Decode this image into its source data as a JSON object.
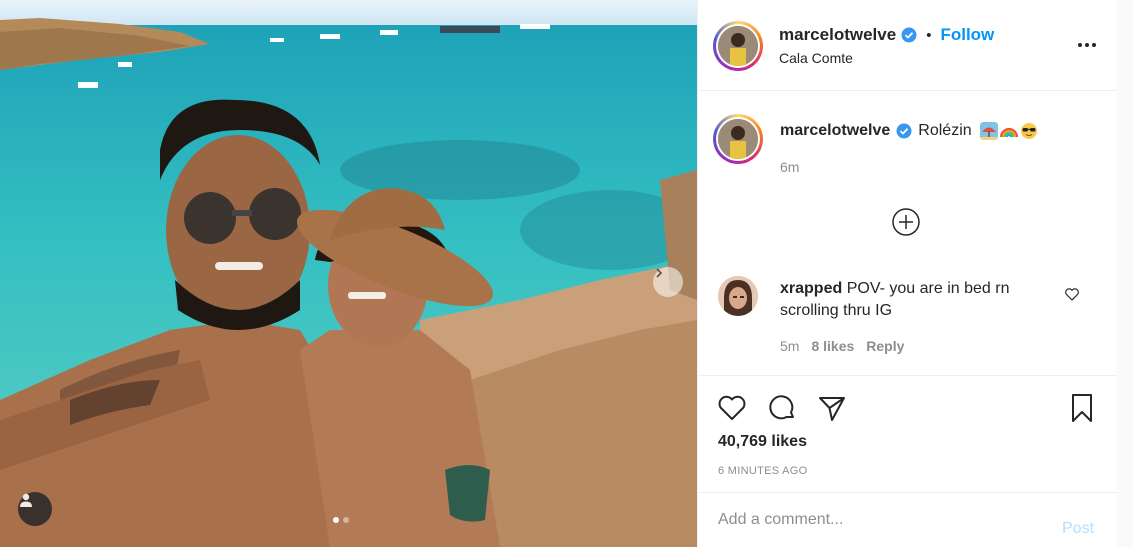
{
  "post": {
    "photo_alt": "",
    "carousel_dots": 2
  },
  "header": {
    "username": "marcelotwelve",
    "separator": "•",
    "follow_label": "Follow",
    "location": "Cala Comte"
  },
  "caption": {
    "username": "marcelotwelve",
    "text": "Rolézin",
    "emojis": [
      "beach-umbrella-emoji",
      "rainbow-emoji",
      "sunglasses-emoji"
    ],
    "time": "6m"
  },
  "comment": {
    "username": "xrapped",
    "text": "POV- you are in bed rn scrolling thru IG",
    "time": "5m",
    "likes": "8 likes",
    "reply_label": "Reply"
  },
  "actions": {
    "likes": "40,769 likes",
    "time_ago": "6 MINUTES AGO"
  },
  "add_comment": {
    "placeholder": "Add a comment...",
    "post_label": "Post"
  },
  "colors": {
    "link_blue": "#0095f6",
    "muted": "#8e8e8e",
    "post_disabled": "#b2dffc"
  }
}
